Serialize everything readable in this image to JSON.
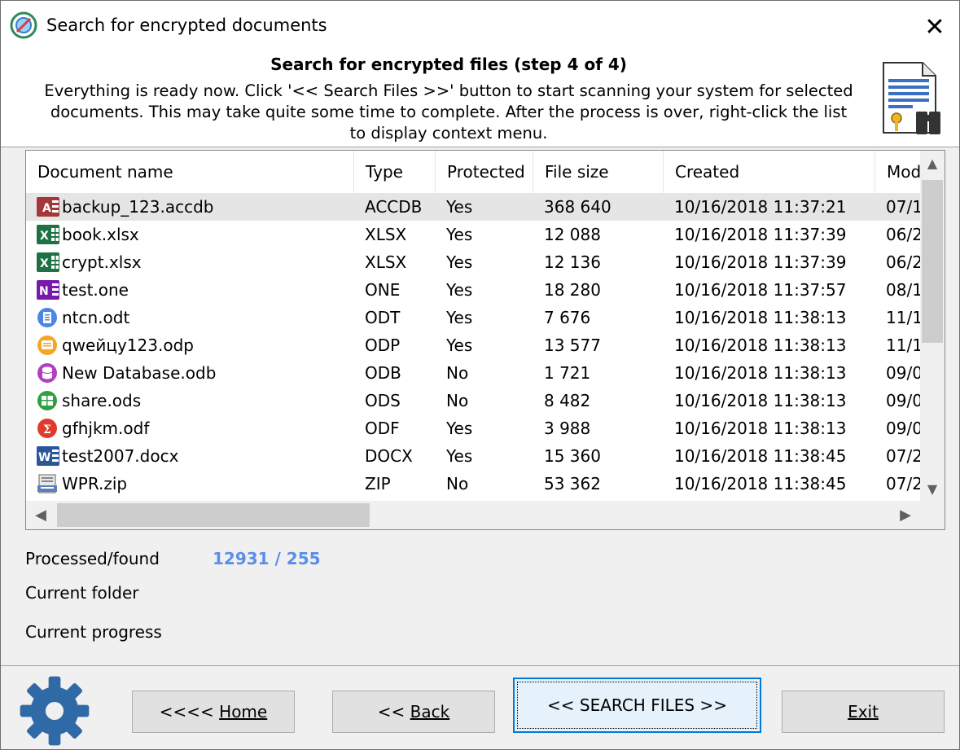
{
  "window": {
    "title": "Search for encrypted documents",
    "close_glyph": "✕"
  },
  "header": {
    "step_title": "Search for encrypted files (step 4 of 4)",
    "description": "Everything is ready now. Click '<< Search Files >>' button to start scanning your system for selected documents. This may take quite some time to complete. After the process is over, right-click the list to display context menu.",
    "icon": "document-key-binoculars-icon"
  },
  "list": {
    "columns": [
      "Document name",
      "Type",
      "Protected",
      "File size",
      "Created",
      "Mod"
    ],
    "rows": [
      {
        "name": "backup_123.accdb",
        "type": "ACCDB",
        "protected": "Yes",
        "size": "368 640",
        "created": "10/16/2018 11:37:21",
        "mod": "07/1",
        "icon": "access-icon",
        "selected": true
      },
      {
        "name": "book.xlsx",
        "type": "XLSX",
        "protected": "Yes",
        "size": "12 088",
        "created": "10/16/2018 11:37:39",
        "mod": "06/2",
        "icon": "excel-icon"
      },
      {
        "name": "crypt.xlsx",
        "type": "XLSX",
        "protected": "Yes",
        "size": "12 136",
        "created": "10/16/2018 11:37:39",
        "mod": "06/2",
        "icon": "excel-icon"
      },
      {
        "name": "test.one",
        "type": "ONE",
        "protected": "Yes",
        "size": "18 280",
        "created": "10/16/2018 11:37:57",
        "mod": "08/1",
        "icon": "onenote-icon"
      },
      {
        "name": "ntcn.odt",
        "type": "ODT",
        "protected": "Yes",
        "size": "7 676",
        "created": "10/16/2018 11:38:13",
        "mod": "11/1",
        "icon": "odt-icon"
      },
      {
        "name": "qweйцу123.odp",
        "type": "ODP",
        "protected": "Yes",
        "size": "13 577",
        "created": "10/16/2018 11:38:13",
        "mod": "11/1",
        "icon": "odp-icon"
      },
      {
        "name": "New Database.odb",
        "type": "ODB",
        "protected": "No",
        "size": "1 721",
        "created": "10/16/2018 11:38:13",
        "mod": "09/0",
        "icon": "odb-icon"
      },
      {
        "name": "share.ods",
        "type": "ODS",
        "protected": "No",
        "size": "8 482",
        "created": "10/16/2018 11:38:13",
        "mod": "09/0",
        "icon": "ods-icon"
      },
      {
        "name": "gfhjkm.odf",
        "type": "ODF",
        "protected": "Yes",
        "size": "3 988",
        "created": "10/16/2018 11:38:13",
        "mod": "09/0",
        "icon": "odf-icon"
      },
      {
        "name": "test2007.docx",
        "type": "DOCX",
        "protected": "Yes",
        "size": "15 360",
        "created": "10/16/2018 11:38:45",
        "mod": "07/2",
        "icon": "word-icon"
      },
      {
        "name": "WPR.zip",
        "type": "ZIP",
        "protected": "No",
        "size": "53 362",
        "created": "10/16/2018 11:38:45",
        "mod": "07/2",
        "icon": "zip-icon"
      }
    ]
  },
  "status": {
    "processed_label": "Processed/found",
    "processed_value": "12931 / 255",
    "folder_label": "Current folder",
    "progress_label": "Current progress"
  },
  "footer": {
    "home_prefix": "<<<< ",
    "home_label": "Home",
    "back_prefix": "<< ",
    "back_label": "Back",
    "search_label": "<< SEARCH FILES >>",
    "exit_label": "Exit"
  },
  "colors": {
    "accent": "#0078d7",
    "processed_value": "#5b8ee6",
    "gear": "#2f6aa6"
  }
}
